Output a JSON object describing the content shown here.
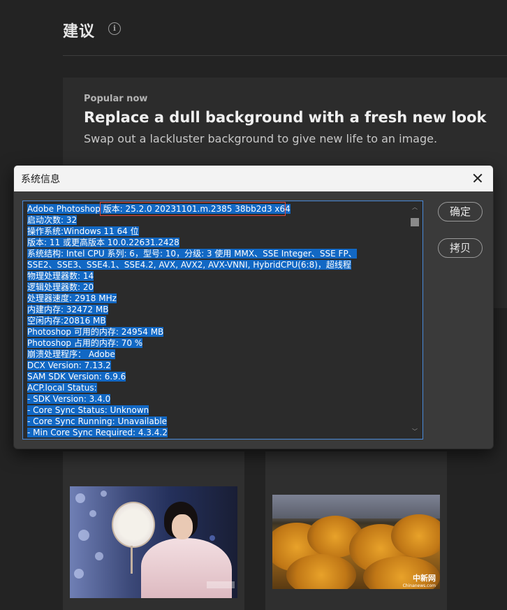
{
  "page": {
    "heading": "建议",
    "info_icon": "info-icon",
    "promo": {
      "eyebrow": "Popular now",
      "title": "Replace a dull background with a fresh new look",
      "subtitle": "Swap out a lackluster background to give new life to an image."
    },
    "thumbnails": [
      {
        "icon": "photo-woman-with-fan"
      },
      {
        "icon": "photo-autumn-trees",
        "watermark": "中新网",
        "watermark_sub": "Chinanews.com"
      }
    ]
  },
  "dialog": {
    "title": "系统信息",
    "close_icon": "close-icon",
    "buttons": {
      "ok": "确定",
      "copy": "拷贝"
    },
    "lines": [
      "Adobe Photoshop 版本: 25.2.0 20231101.m.2385 38bb2d3  x64",
      "启动次数: 32",
      "操作系统:Windows 11 64 位",
      "版本: 11 或更高版本 10.0.22631.2428",
      "系统结构: Intel CPU 系列: 6，型号: 10，分级: 3 使用 MMX、SSE Integer、SSE FP、",
      "SSE2、SSE3、SSE4.1、SSE4.2, AVX, AVX2, AVX-VNNI, HybridCPU(6:8)，超线程",
      "物理处理器数: 14",
      "逻辑处理器数: 20",
      "处理器速度: 2918 MHz",
      "内建内存: 32472 MB",
      "空闲内存:20816 MB",
      "Photoshop 可用的内存: 24954 MB",
      "Photoshop 占用的内存: 70 %",
      "崩溃处理程序： Adobe",
      "DCX Version: 7.13.2",
      "SAM SDK Version: 6.9.6",
      "ACP.local Status:",
      " - SDK Version: 3.4.0",
      " - Core Sync Status: Unknown",
      " - Core Sync Running: Unavailable",
      " - Min Core Sync Required: 4.3.4.2"
    ]
  },
  "colors": {
    "selection": "#1268c4",
    "highlight_box": "#e24a3a",
    "focus_border": "#4a8ad9"
  }
}
